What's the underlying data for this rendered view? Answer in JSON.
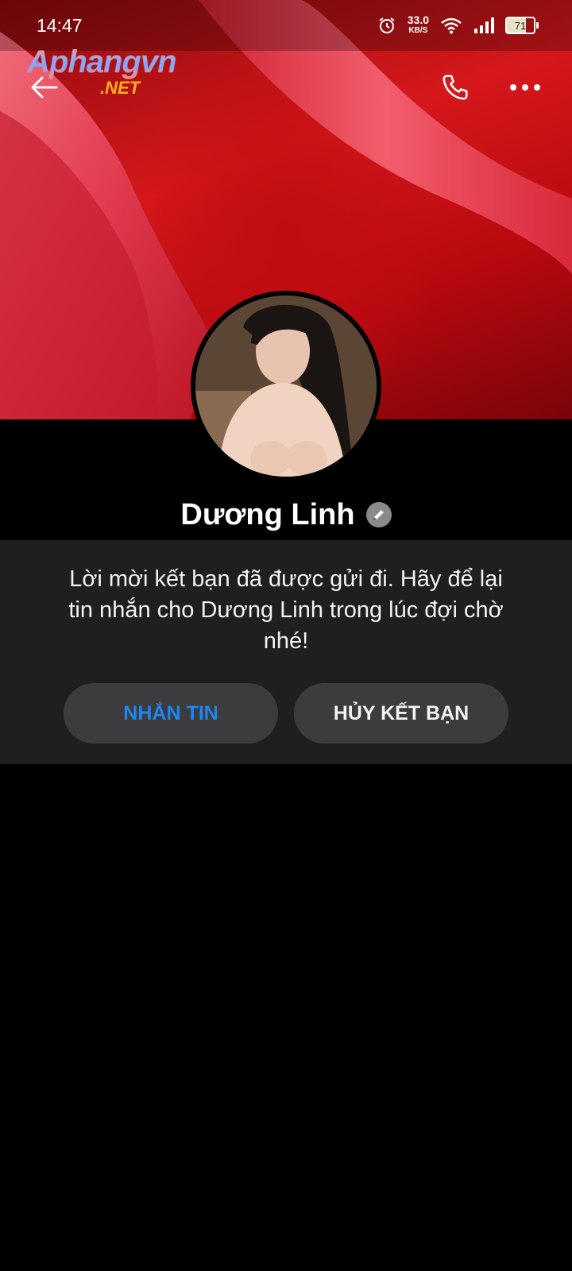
{
  "status_bar": {
    "time": "14:47",
    "net_speed_value": "33.0",
    "net_speed_unit": "KB/S",
    "battery": "71",
    "icons": [
      "alarm-icon",
      "wifi-icon",
      "signal-icon",
      "battery-icon"
    ]
  },
  "watermark": {
    "top": "Aphangvn",
    "bottom": ".NET"
  },
  "header": {
    "icons": [
      "back-arrow-icon",
      "phone-icon",
      "more-icon"
    ]
  },
  "profile": {
    "name": "Dương Linh",
    "badge_icon": "pencil-icon"
  },
  "friend_request": {
    "message": "Lời mời kết bạn đã được gửi đi. Hãy để lại tin nhắn cho Dương Linh trong lúc đợi chờ nhé!",
    "message_button": "NHẮN TIN",
    "unfriend_button": "HỦY KẾT BẠN"
  },
  "colors": {
    "background": "#000000",
    "panel": "#1f1f1f",
    "button_bg": "#3c3c3e",
    "accent_blue": "#1d86f0",
    "cover_red": "#d5181c"
  }
}
